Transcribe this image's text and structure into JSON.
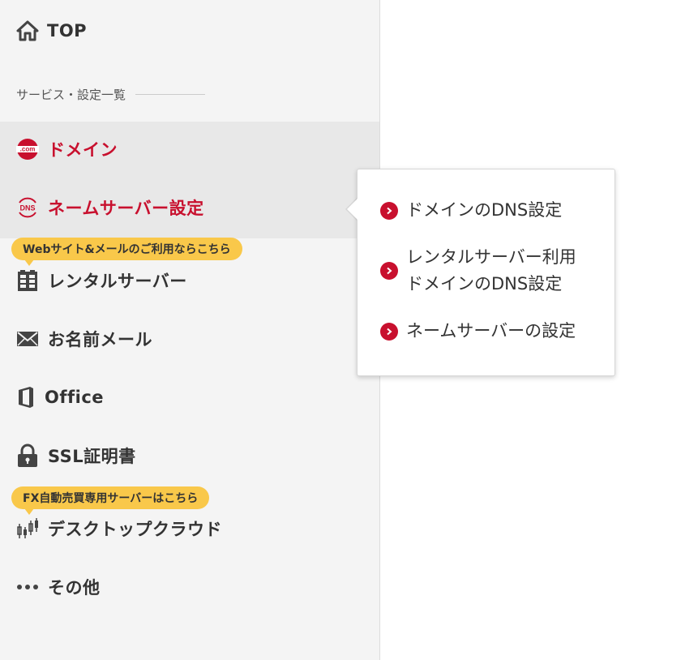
{
  "sidebar": {
    "top_label": "TOP",
    "section_heading": "サービス・設定一覧",
    "items": {
      "domain": "ドメイン",
      "nameserver": "ネームサーバー設定",
      "rental_server": "レンタルサーバー",
      "mail": "お名前メール",
      "office": "Office",
      "ssl": "SSL証明書",
      "desktop_cloud": "デスクトップクラウド",
      "other": "その他"
    },
    "badges": {
      "rental_server": "Webサイト&メールのご利用ならこちら",
      "desktop_cloud": "FX自動売買専用サーバーはこちら"
    },
    "icons": {
      "top": "home-icon",
      "domain": "dotcom-icon",
      "nameserver": "dns-icon",
      "rental_server": "server-icon",
      "mail": "envelope-icon",
      "office": "office-icon",
      "ssl": "lock-icon",
      "desktop_cloud": "candlestick-chart-icon",
      "other": "more-dots-icon"
    },
    "dotcom_icon_text": ".com",
    "dns_icon_text": "DNS"
  },
  "popup": {
    "links": [
      "ドメインのDNS設定",
      "レンタルサーバー利用\nドメインのDNS設定",
      "ネームサーバーの設定"
    ]
  },
  "colors": {
    "accent_red": "#c8102e",
    "badge_yellow": "#f9c84a",
    "sidebar_bg": "#f4f4f4",
    "active_bg": "#e8e8e8"
  }
}
